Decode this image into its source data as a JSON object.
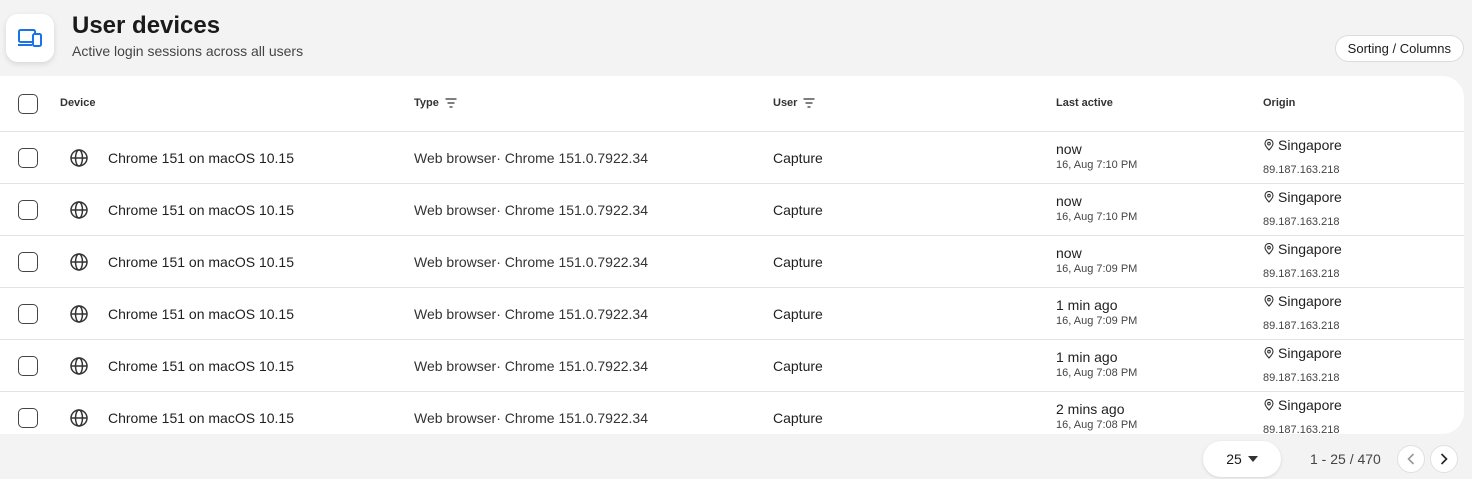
{
  "header": {
    "title": "User devices",
    "subtitle": "Active login sessions across all users",
    "icon": "devices-icon",
    "sorting_button": "Sorting / Columns",
    "accent": "#1a73e8"
  },
  "table": {
    "columns": {
      "device": "Device",
      "type": "Type",
      "user": "User",
      "last_active": "Last active",
      "origin": "Origin"
    },
    "rows": [
      {
        "device": "Chrome 151 on macOS 10.15",
        "type": "Web browser· Chrome 151.0.7922.34",
        "user": "Capture",
        "active": "now",
        "active_time": "16, Aug 7:10 PM",
        "city": "Singapore",
        "ip": "89.187.163.218"
      },
      {
        "device": "Chrome 151 on macOS 10.15",
        "type": "Web browser· Chrome 151.0.7922.34",
        "user": "Capture",
        "active": "now",
        "active_time": "16, Aug 7:10 PM",
        "city": "Singapore",
        "ip": "89.187.163.218"
      },
      {
        "device": "Chrome 151 on macOS 10.15",
        "type": "Web browser· Chrome 151.0.7922.34",
        "user": "Capture",
        "active": "now",
        "active_time": "16, Aug 7:09 PM",
        "city": "Singapore",
        "ip": "89.187.163.218"
      },
      {
        "device": "Chrome 151 on macOS 10.15",
        "type": "Web browser· Chrome 151.0.7922.34",
        "user": "Capture",
        "active": "1 min ago",
        "active_time": "16, Aug 7:09 PM",
        "city": "Singapore",
        "ip": "89.187.163.218"
      },
      {
        "device": "Chrome 151 on macOS 10.15",
        "type": "Web browser· Chrome 151.0.7922.34",
        "user": "Capture",
        "active": "1 min ago",
        "active_time": "16, Aug 7:08 PM",
        "city": "Singapore",
        "ip": "89.187.163.218"
      },
      {
        "device": "Chrome 151 on macOS 10.15",
        "type": "Web browser· Chrome 151.0.7922.34",
        "user": "Capture",
        "active": "2 mins ago",
        "active_time": "16, Aug 7:08 PM",
        "city": "Singapore",
        "ip": "89.187.163.218"
      }
    ]
  },
  "pagination": {
    "page_size": "25",
    "range": "1 - 25 / 470"
  }
}
